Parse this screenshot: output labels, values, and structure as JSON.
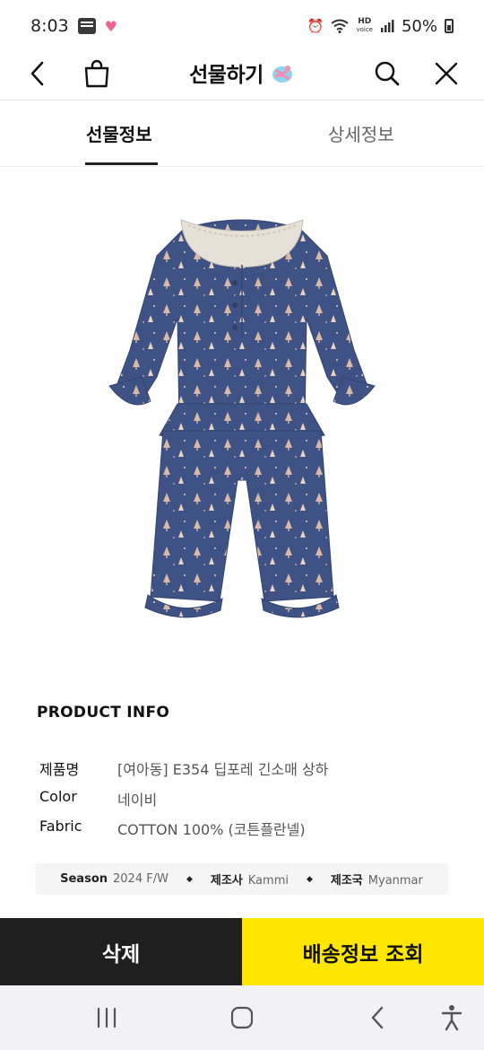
{
  "status_bar": {
    "time": "8:03",
    "hd_label": "HD",
    "voice_label": "voice",
    "battery": "50%"
  },
  "header": {
    "title": "선물하기"
  },
  "tabs": [
    {
      "label": "선물정보",
      "active": true
    },
    {
      "label": "상세정보",
      "active": false
    }
  ],
  "product_info": {
    "title": "PRODUCT INFO",
    "rows": [
      {
        "label": "제품명",
        "value": "[여아동] E354 딥포레 긴소매 상하"
      },
      {
        "label": "Color",
        "value": "네이비"
      },
      {
        "label": "Fabric",
        "value": "COTTON 100% (코튼플란넬)"
      }
    ]
  },
  "meta": [
    {
      "label": "Season",
      "value": "2024 F/W"
    },
    {
      "label": "제조사",
      "value": "Kammi"
    },
    {
      "label": "제조국",
      "value": "Myanmar"
    }
  ],
  "actions": {
    "delete_label": "삭제",
    "shipping_label": "배송정보 조회"
  },
  "colors": {
    "accent_yellow": "#ffe600",
    "dark_button": "#1f1f1f",
    "garment_navy": "#3f5286"
  }
}
